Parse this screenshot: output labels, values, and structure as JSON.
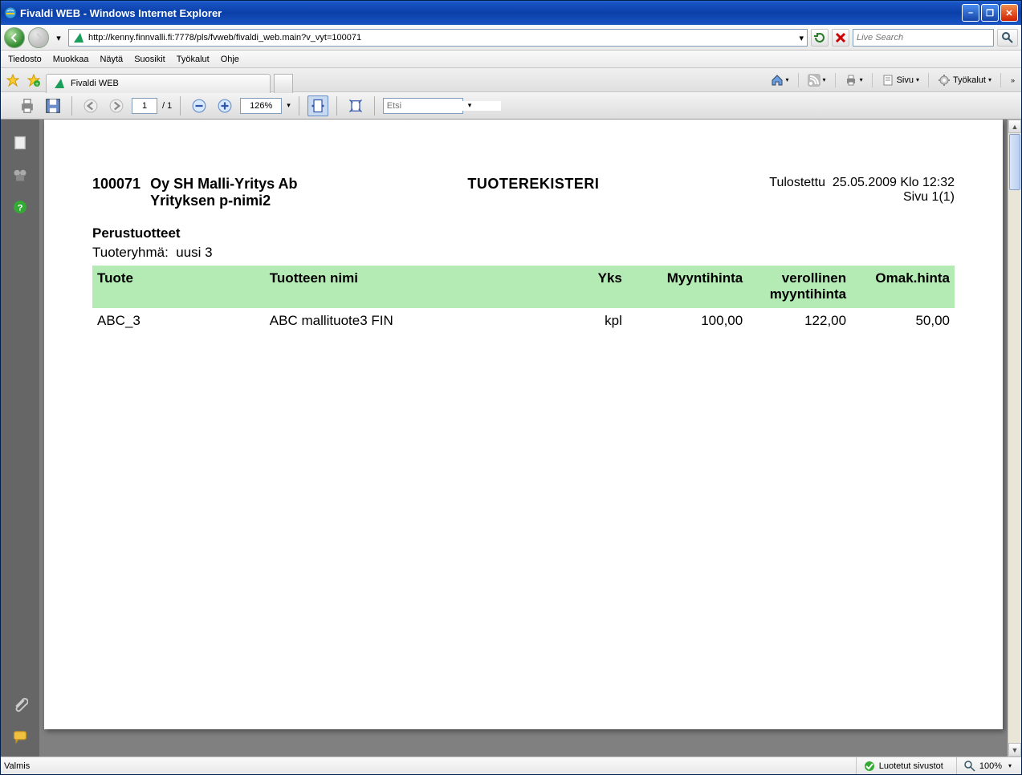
{
  "window": {
    "title": "Fivaldi WEB - Windows Internet Explorer"
  },
  "address": {
    "url": "http://kenny.finnvalli.fi:7778/pls/fvweb/fivaldi_web.main?v_vyt=100071"
  },
  "search": {
    "placeholder": "Live Search"
  },
  "menu": {
    "items": [
      "Tiedosto",
      "Muokkaa",
      "Näytä",
      "Suosikit",
      "Työkalut",
      "Ohje"
    ]
  },
  "tab": {
    "title": "Fivaldi WEB"
  },
  "cmd": {
    "sivu": "Sivu",
    "tyokalut": "Työkalut"
  },
  "pdf": {
    "page_current": "1",
    "page_total": "/ 1",
    "zoom": "126%",
    "find_placeholder": "Etsi"
  },
  "report": {
    "org_code": "100071",
    "org_name": "Oy SH Malli-Yritys Ab",
    "org_name2": "Yrityksen p-nimi2",
    "title": "TUOTEREKISTERI",
    "printed_label": "Tulostettu",
    "printed_value": "25.05.2009 Klo 12:32",
    "page_label": "Sivu 1(1)",
    "section_title": "Perustuotteet",
    "group_label": "Tuoteryhmä:",
    "group_value": "uusi 3",
    "columns": {
      "c1": "Tuote",
      "c2": "Tuotteen nimi",
      "c3": "Yks",
      "c4": "Myyntihinta",
      "c5a": "verollinen",
      "c5b": "myyntihinta",
      "c6": "Omak.hinta"
    },
    "rows": [
      {
        "code": "ABC_3",
        "name": "ABC mallituote3 FIN",
        "unit": "kpl",
        "price": "100,00",
        "price_vat": "122,00",
        "cost": "50,00"
      }
    ]
  },
  "status": {
    "left": "Valmis",
    "security": "Luotetut sivustot",
    "zoom": "100%"
  }
}
